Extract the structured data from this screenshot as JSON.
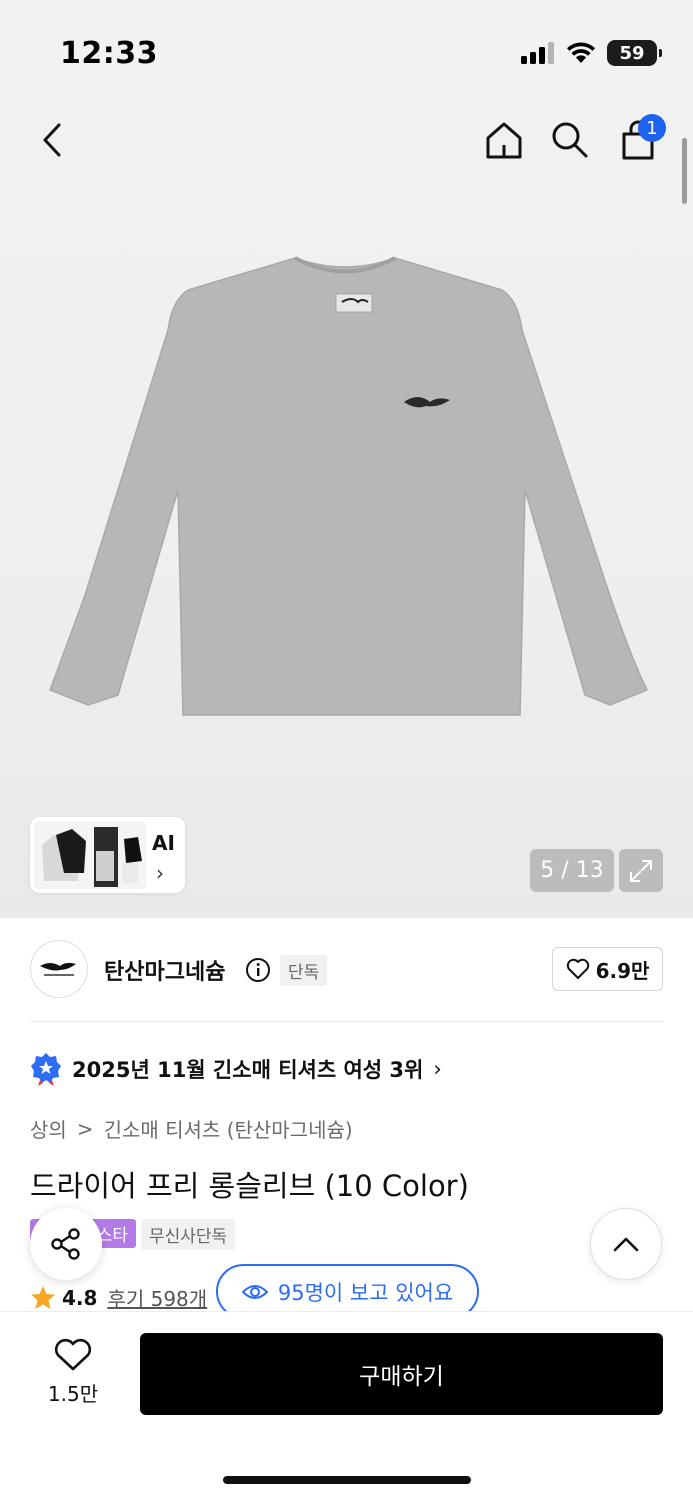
{
  "status_bar": {
    "time": "12:33",
    "battery": "59"
  },
  "nav": {
    "cart_count": "1"
  },
  "gallery": {
    "thumb_label": "AI",
    "counter": "5 / 13",
    "shirt_color": "#b9b9b9"
  },
  "brand": {
    "name": "탄산마그네슘",
    "exclusive_tag": "단독",
    "like_count": "6.9만"
  },
  "ranking": {
    "text": "2025년 11월 긴소매 티셔츠 여성 3위"
  },
  "breadcrumb": {
    "category": "상의",
    "separator": ">",
    "subcategory": "긴소매 티셔츠 (탄산마그네슘)"
  },
  "product": {
    "title": "드라이어 프리 롱슬리브 (10 Color)",
    "tag_purple": "스타",
    "tag_exclusive": "무신사단독",
    "rating": "4.8",
    "review_link": "후기 598개",
    "viewers": "95명이 보고 있어요"
  },
  "bottom": {
    "wish_count": "1.5만",
    "buy_label": "구매하기"
  },
  "colors": {
    "accent_blue": "#2d6cf5",
    "badge_blue": "#1d63f0",
    "purple": "#b47be8",
    "star": "#f5a623"
  }
}
